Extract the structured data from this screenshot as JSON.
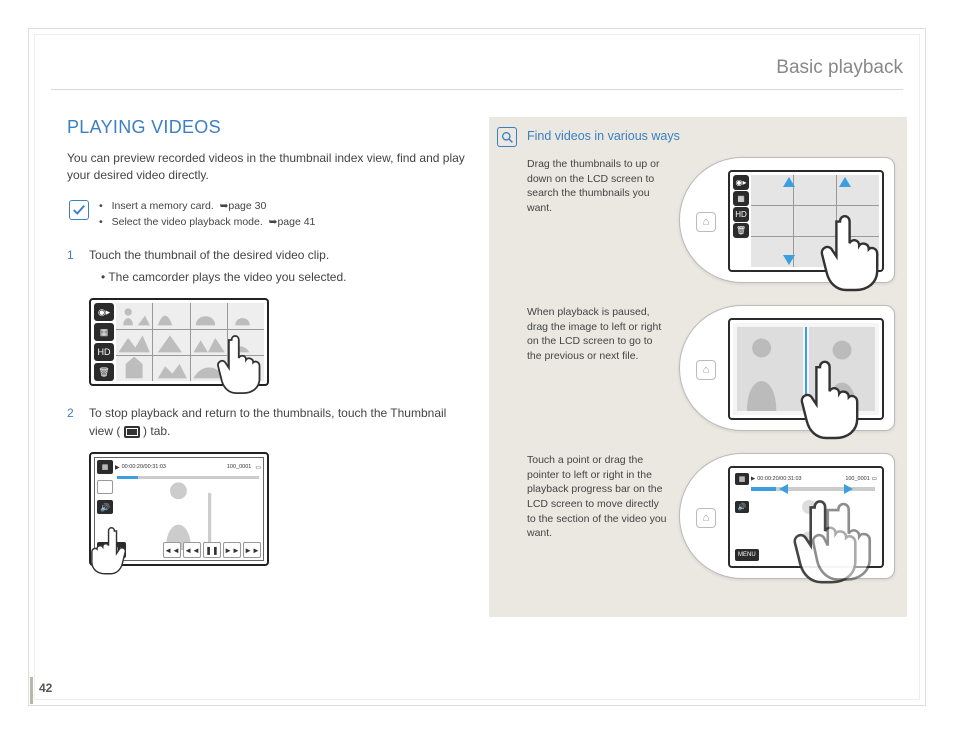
{
  "header": {
    "section_title": "Basic playback"
  },
  "main": {
    "heading": "PLAYING VIDEOS",
    "intro": "You can preview recorded videos in the thumbnail index view, find and play your desired video directly.",
    "prereq": {
      "items": [
        {
          "text": "Insert a memory card.",
          "page_ref": "page 30"
        },
        {
          "text": "Select the video playback mode.",
          "page_ref": "page 41"
        }
      ]
    },
    "steps": [
      {
        "num": "1",
        "text": "Touch the thumbnail of the desired video clip.",
        "bullet": "The camcorder plays the video you selected."
      },
      {
        "num": "2",
        "text_before": "To stop playback and return to the thumbnails, touch the Thumbnail view (",
        "text_after": ") tab."
      }
    ],
    "playback_osd": {
      "time": "00:00:20/00:31:03",
      "file": "100_0001",
      "menu_label": "MENU"
    }
  },
  "sidebox": {
    "title": "Find videos in various ways",
    "rows": [
      {
        "text": "Drag the thumbnails to up or down on the LCD screen to search the thumbnails you want."
      },
      {
        "text": "When playback is paused, drag the image to left or right on the LCD screen to go to the previous or next file."
      },
      {
        "text": "Touch a point or drag the pointer to left or right in the playback progress bar on the LCD screen to move directly to the section of the video you want."
      }
    ],
    "device3_osd": {
      "time": "00:00:20/00:31:03",
      "file": "100_0001",
      "menu_label": "MENU"
    }
  },
  "page_number": "42"
}
